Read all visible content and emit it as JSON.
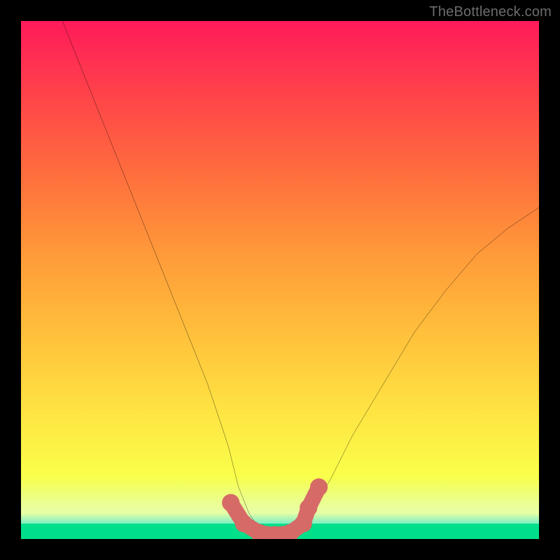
{
  "watermark": {
    "text": "TheBottleneck.com"
  },
  "chart_data": {
    "type": "line",
    "title": "",
    "xlabel": "",
    "ylabel": "",
    "xlim": [
      0,
      100
    ],
    "ylim": [
      0,
      100
    ],
    "grid": false,
    "legend": false,
    "series": [
      {
        "name": "bottleneck-curve",
        "x": [
          8,
          12,
          16,
          20,
          24,
          28,
          32,
          36,
          40,
          42,
          44,
          46,
          48,
          50,
          52,
          54,
          56,
          60,
          64,
          70,
          76,
          82,
          88,
          94,
          100
        ],
        "values": [
          100,
          90,
          80,
          70,
          60,
          50,
          40,
          30,
          18,
          10,
          5,
          2,
          1,
          0.5,
          1,
          2,
          5,
          12,
          20,
          30,
          40,
          48,
          55,
          60,
          64
        ]
      }
    ],
    "highlight": {
      "name": "markers",
      "color": "#d66a66",
      "points_x": [
        40.5,
        43,
        46,
        49,
        52,
        54.5,
        55.5,
        57.5
      ],
      "points_y": [
        7,
        3,
        1.2,
        0.8,
        1.2,
        3,
        6,
        10
      ]
    },
    "background": {
      "type": "vertical-gradient",
      "stops": [
        {
          "pos": 0,
          "color": "#00e08a"
        },
        {
          "pos": 3,
          "color": "#00e08a"
        },
        {
          "pos": 5,
          "color": "#d8ff66"
        },
        {
          "pos": 12,
          "color": "#f9ff4a"
        },
        {
          "pos": 25,
          "color": "#ffe342"
        },
        {
          "pos": 40,
          "color": "#ffbf3b"
        },
        {
          "pos": 55,
          "color": "#ff9a39"
        },
        {
          "pos": 70,
          "color": "#ff6f3d"
        },
        {
          "pos": 85,
          "color": "#ff4549"
        },
        {
          "pos": 100,
          "color": "#ff1a5a"
        }
      ]
    }
  }
}
